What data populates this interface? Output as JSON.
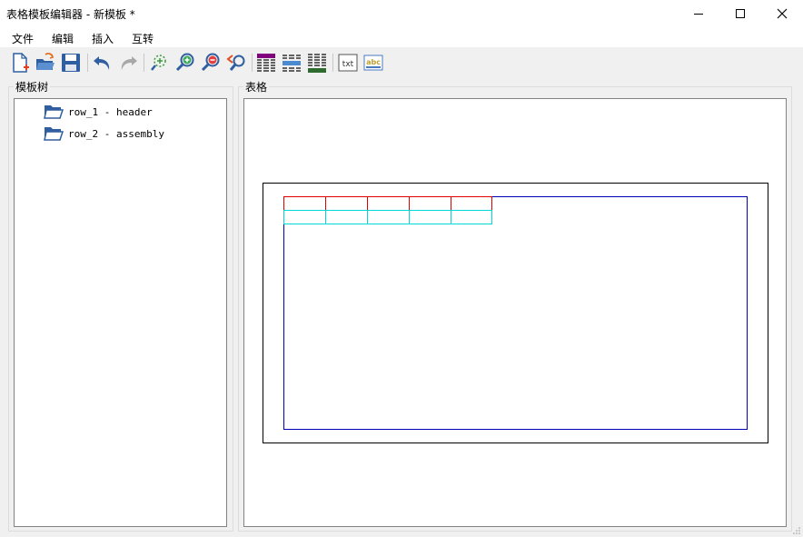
{
  "window": {
    "title": "表格模板编辑器 - 新模板 *"
  },
  "menu": {
    "items": [
      "文件",
      "编辑",
      "插入",
      "互转"
    ]
  },
  "toolbar": {
    "buttons": [
      "new-file",
      "open-folder",
      "save",
      "undo",
      "redo",
      "zoom-fit",
      "zoom-in",
      "zoom-out",
      "zoom-reset",
      "table-style-header",
      "table-style-body",
      "table-style-footer",
      "text-box",
      "text-field"
    ]
  },
  "panels": {
    "tree_label": "模板树",
    "canvas_label": "表格"
  },
  "tree": {
    "nodes": [
      {
        "label": "row_1 - header"
      },
      {
        "label": "row_2 - assembly"
      }
    ]
  },
  "toolbar_text": {
    "txt_glyph": "txt",
    "abc_glyph": "abc"
  },
  "colors": {
    "header_row_border": "#e00000",
    "assembly_row_border": "#00d8d8",
    "table_border": "#0000b4",
    "page_border": "#000000",
    "folder": "#2f5fa0"
  }
}
